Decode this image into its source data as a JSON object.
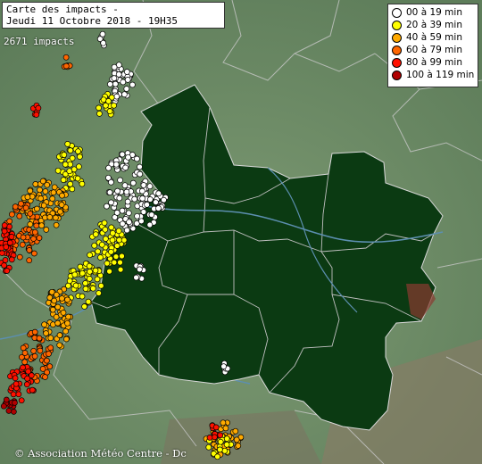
{
  "title": {
    "line1": "Carte des impacts -",
    "line2": "Jeudi 11 Octobre 2018 - 19H35"
  },
  "impacts_count": "2671 impacts",
  "legend": [
    {
      "label": "00 à 19 min",
      "color": "#ffffff"
    },
    {
      "label": "20 à 39 min",
      "color": "#ffff00"
    },
    {
      "label": "40 à 59 min",
      "color": "#ffaa00"
    },
    {
      "label": "60 à 79 min",
      "color": "#ff6600"
    },
    {
      "label": "80 à 99 min",
      "color": "#ff1100"
    },
    {
      "label": "100 à 119 min",
      "color": "#b00000"
    }
  ],
  "copyright": "© Association Météo Centre - Dc",
  "colors": {
    "background_relief": "#6f8f6a",
    "highlighted_region": "#0b3a12",
    "borders": "#c8c8c8",
    "rivers": "#5c8fb0"
  }
}
